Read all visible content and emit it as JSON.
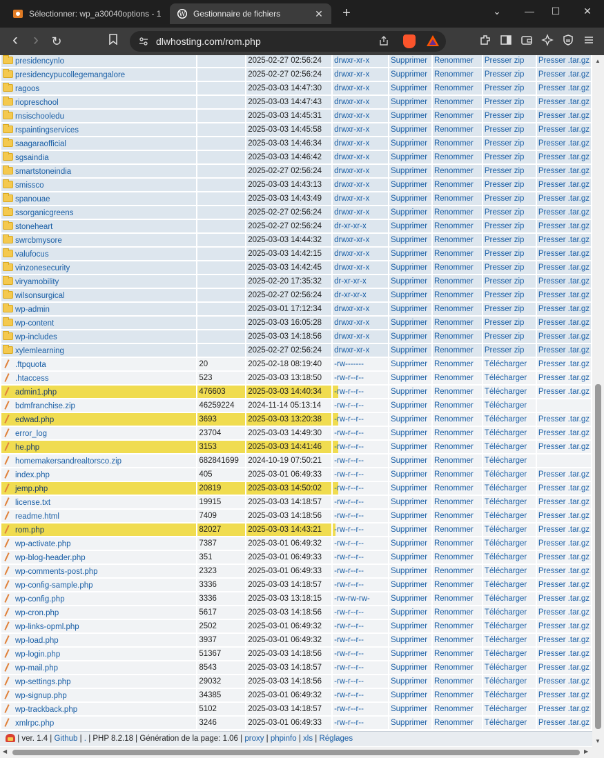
{
  "browser": {
    "tabs": [
      {
        "title": "Sélectionner: wp_a30040options - 1",
        "active": false,
        "icon": "database-icon"
      },
      {
        "title": "Gestionnaire de fichiers",
        "active": true,
        "icon": "wordpress-icon",
        "close": "✕"
      }
    ],
    "new_tab": "+",
    "window_controls": {
      "tabs_menu": "⌄",
      "minimize": "—",
      "maximize": "☐",
      "close": "✕"
    },
    "nav": {
      "back": "‹",
      "forward": "›",
      "reload": "↻",
      "bookmark": "🔖"
    },
    "url": "dlwhosting.com/rom.php"
  },
  "directories": [
    {
      "name": "presidencynlo",
      "date": "2025-02-27 02:56:24",
      "perms": "drwxr-xr-x"
    },
    {
      "name": "presidencypucollegemangalore",
      "date": "2025-02-27 02:56:24",
      "perms": "drwxr-xr-x"
    },
    {
      "name": "ragoos",
      "date": "2025-03-03 14:47:30",
      "perms": "drwxr-xr-x"
    },
    {
      "name": "riopreschool",
      "date": "2025-03-03 14:47:43",
      "perms": "drwxr-xr-x"
    },
    {
      "name": "rnsischooledu",
      "date": "2025-03-03 14:45:31",
      "perms": "drwxr-xr-x"
    },
    {
      "name": "rspaintingservices",
      "date": "2025-03-03 14:45:58",
      "perms": "drwxr-xr-x"
    },
    {
      "name": "saagaraofficial",
      "date": "2025-03-03 14:46:34",
      "perms": "drwxr-xr-x"
    },
    {
      "name": "sgsaindia",
      "date": "2025-03-03 14:46:42",
      "perms": "drwxr-xr-x"
    },
    {
      "name": "smartstoneindia",
      "date": "2025-02-27 02:56:24",
      "perms": "drwxr-xr-x"
    },
    {
      "name": "smissco",
      "date": "2025-03-03 14:43:13",
      "perms": "drwxr-xr-x"
    },
    {
      "name": "spanouae",
      "date": "2025-03-03 14:43:49",
      "perms": "drwxr-xr-x"
    },
    {
      "name": "ssorganicgreens",
      "date": "2025-02-27 02:56:24",
      "perms": "drwxr-xr-x"
    },
    {
      "name": "stoneheart",
      "date": "2025-02-27 02:56:24",
      "perms": "dr-xr-xr-x"
    },
    {
      "name": "swrcbmysore",
      "date": "2025-03-03 14:44:32",
      "perms": "drwxr-xr-x"
    },
    {
      "name": "valufocus",
      "date": "2025-03-03 14:42:15",
      "perms": "drwxr-xr-x"
    },
    {
      "name": "vinzonesecurity",
      "date": "2025-03-03 14:42:45",
      "perms": "drwxr-xr-x"
    },
    {
      "name": "viryamobility",
      "date": "2025-02-20 17:35:32",
      "perms": "dr-xr-xr-x"
    },
    {
      "name": "wilsonsurgical",
      "date": "2025-02-27 02:56:24",
      "perms": "dr-xr-xr-x"
    },
    {
      "name": "wp-admin",
      "date": "2025-03-01 17:12:34",
      "perms": "drwxr-xr-x"
    },
    {
      "name": "wp-content",
      "date": "2025-03-03 16:05:28",
      "perms": "drwxr-xr-x"
    },
    {
      "name": "wp-includes",
      "date": "2025-03-03 14:18:56",
      "perms": "drwxr-xr-x"
    },
    {
      "name": "xylemlearning",
      "date": "2025-02-27 02:56:24",
      "perms": "drwxr-xr-x"
    }
  ],
  "files": [
    {
      "name": ".ftpquota",
      "size": "20",
      "date": "2025-02-18 08:19:40",
      "perms": "-rw-------",
      "tar": true
    },
    {
      "name": ".htaccess",
      "size": "523",
      "date": "2025-03-03 13:18:50",
      "perms": "-rw-r--r--",
      "tar": true
    },
    {
      "name": "admin1.php",
      "size": "476603",
      "date": "2025-03-03 14:40:34",
      "perms": "-rw-r--r--",
      "tar": true,
      "highlight": true
    },
    {
      "name": "bdmfranchise.zip",
      "size": "46259224",
      "date": "2024-11-14 05:13:14",
      "perms": "-rw-r--r--",
      "tar": false
    },
    {
      "name": "edwad.php",
      "size": "3693",
      "date": "2025-03-03 13:20:38",
      "perms": "-rw-r--r--",
      "tar": true,
      "highlight": true
    },
    {
      "name": "error_log",
      "size": "23704",
      "date": "2025-03-03 14:49:30",
      "perms": "-rw-r--r--",
      "tar": true
    },
    {
      "name": "he.php",
      "size": "3153",
      "date": "2025-03-03 14:41:46",
      "perms": "-rw-r--r--",
      "tar": true,
      "highlight": true
    },
    {
      "name": "homemakersandrealtorsco.zip",
      "size": "682841699",
      "date": "2024-10-19 07:50:21",
      "perms": "-rw-r--r--",
      "tar": false
    },
    {
      "name": "index.php",
      "size": "405",
      "date": "2025-03-01 06:49:33",
      "perms": "-rw-r--r--",
      "tar": true
    },
    {
      "name": "jemp.php",
      "size": "20819",
      "date": "2025-03-03 14:50:02",
      "perms": "-rw-r--r--",
      "tar": true,
      "highlight": true
    },
    {
      "name": "license.txt",
      "size": "19915",
      "date": "2025-03-03 14:18:57",
      "perms": "-rw-r--r--",
      "tar": true
    },
    {
      "name": "readme.html",
      "size": "7409",
      "date": "2025-03-03 14:18:56",
      "perms": "-rw-r--r--",
      "tar": true
    },
    {
      "name": "rom.php",
      "size": "82027",
      "date": "2025-03-03 14:43:21",
      "perms": "-rw-r--r--",
      "tar": true,
      "highlight": true,
      "partial": true
    },
    {
      "name": "wp-activate.php",
      "size": "7387",
      "date": "2025-03-01 06:49:32",
      "perms": "-rw-r--r--",
      "tar": true
    },
    {
      "name": "wp-blog-header.php",
      "size": "351",
      "date": "2025-03-01 06:49:33",
      "perms": "-rw-r--r--",
      "tar": true
    },
    {
      "name": "wp-comments-post.php",
      "size": "2323",
      "date": "2025-03-01 06:49:33",
      "perms": "-rw-r--r--",
      "tar": true
    },
    {
      "name": "wp-config-sample.php",
      "size": "3336",
      "date": "2025-03-03 14:18:57",
      "perms": "-rw-r--r--",
      "tar": true
    },
    {
      "name": "wp-config.php",
      "size": "3336",
      "date": "2025-03-03 13:18:15",
      "perms": "-rw-rw-rw-",
      "tar": true
    },
    {
      "name": "wp-cron.php",
      "size": "5617",
      "date": "2025-03-03 14:18:56",
      "perms": "-rw-r--r--",
      "tar": true
    },
    {
      "name": "wp-links-opml.php",
      "size": "2502",
      "date": "2025-03-01 06:49:32",
      "perms": "-rw-r--r--",
      "tar": true
    },
    {
      "name": "wp-load.php",
      "size": "3937",
      "date": "2025-03-01 06:49:32",
      "perms": "-rw-r--r--",
      "tar": true
    },
    {
      "name": "wp-login.php",
      "size": "51367",
      "date": "2025-03-03 14:18:56",
      "perms": "-rw-r--r--",
      "tar": true
    },
    {
      "name": "wp-mail.php",
      "size": "8543",
      "date": "2025-03-03 14:18:57",
      "perms": "-rw-r--r--",
      "tar": true
    },
    {
      "name": "wp-settings.php",
      "size": "29032",
      "date": "2025-03-03 14:18:56",
      "perms": "-rw-r--r--",
      "tar": true
    },
    {
      "name": "wp-signup.php",
      "size": "34385",
      "date": "2025-03-01 06:49:32",
      "perms": "-rw-r--r--",
      "tar": true
    },
    {
      "name": "wp-trackback.php",
      "size": "5102",
      "date": "2025-03-03 14:18:57",
      "perms": "-rw-r--r--",
      "tar": true
    },
    {
      "name": "xmlrpc.php",
      "size": "3246",
      "date": "2025-03-01 06:49:33",
      "perms": "-rw-r--r--",
      "tar": true
    }
  ],
  "actions": {
    "delete": "Supprimer",
    "rename": "Renommer",
    "zip": "Presser zip",
    "download": "Télécharger",
    "tar": "Presser .tar.gz"
  },
  "footer": {
    "version": "| ver. 1.4 |",
    "github": "Github",
    "sep1": "|",
    "dot": ".",
    "php": "| PHP 8.2.18 | Génération de la page: 1.06 |",
    "proxy": "proxy",
    "sep2": "|",
    "phpinfo": "phpinfo",
    "sep3": "|",
    "xls": "xls",
    "sep4": "|",
    "settings": "Réglages"
  },
  "colors": {
    "highlight": "#f0dc50",
    "link": "#1a5fa6",
    "dir_row": "#dde6ee",
    "file_row": "#f1f3f5"
  }
}
